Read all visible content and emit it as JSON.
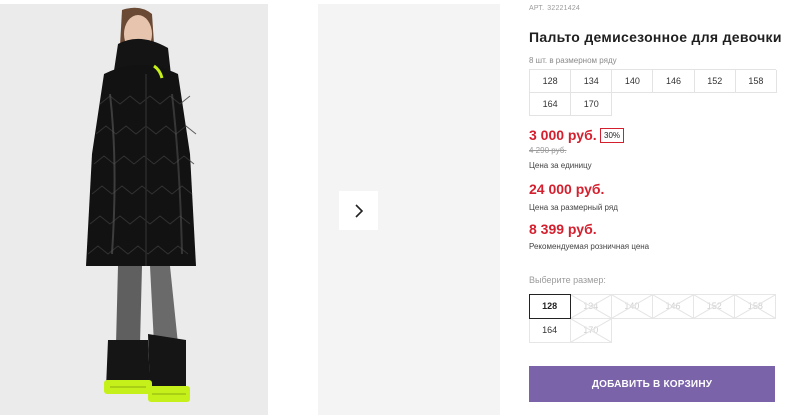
{
  "product": {
    "article_label": "АРТ.",
    "article_number": "32221424",
    "title": "Пальто демисезонное для девочки",
    "image_alt": "product-photo"
  },
  "pack": {
    "caption": "8 шт. в размерном ряду",
    "sizes": [
      "128",
      "134",
      "140",
      "146",
      "152",
      "158",
      "164",
      "170"
    ]
  },
  "prices": {
    "unit_price": "3 000 руб.",
    "discount": "30%",
    "old_price": "4 290 руб.",
    "unit_caption": "Цена за единицу",
    "pack_price": "24 000 руб.",
    "pack_caption": "Цена за размерный ряд",
    "retail_price": "8 399 руб.",
    "retail_caption": "Рекомендуемая розничная цена"
  },
  "size_selector": {
    "label": "Выберите размер:",
    "options": [
      {
        "label": "128",
        "state": "selected"
      },
      {
        "label": "134",
        "state": "disabled"
      },
      {
        "label": "140",
        "state": "disabled"
      },
      {
        "label": "146",
        "state": "disabled"
      },
      {
        "label": "152",
        "state": "disabled"
      },
      {
        "label": "158",
        "state": "disabled"
      },
      {
        "label": "164",
        "state": "available"
      },
      {
        "label": "170",
        "state": "disabled"
      }
    ]
  },
  "cart": {
    "button_label": "ДОБАВИТЬ В КОРЗИНУ"
  },
  "gallery": {
    "next_icon": "chevron-right-icon"
  },
  "colors": {
    "accent_purple": "#7a63a9",
    "price_red": "#d4202e",
    "border_gray": "#e3e3e3"
  }
}
